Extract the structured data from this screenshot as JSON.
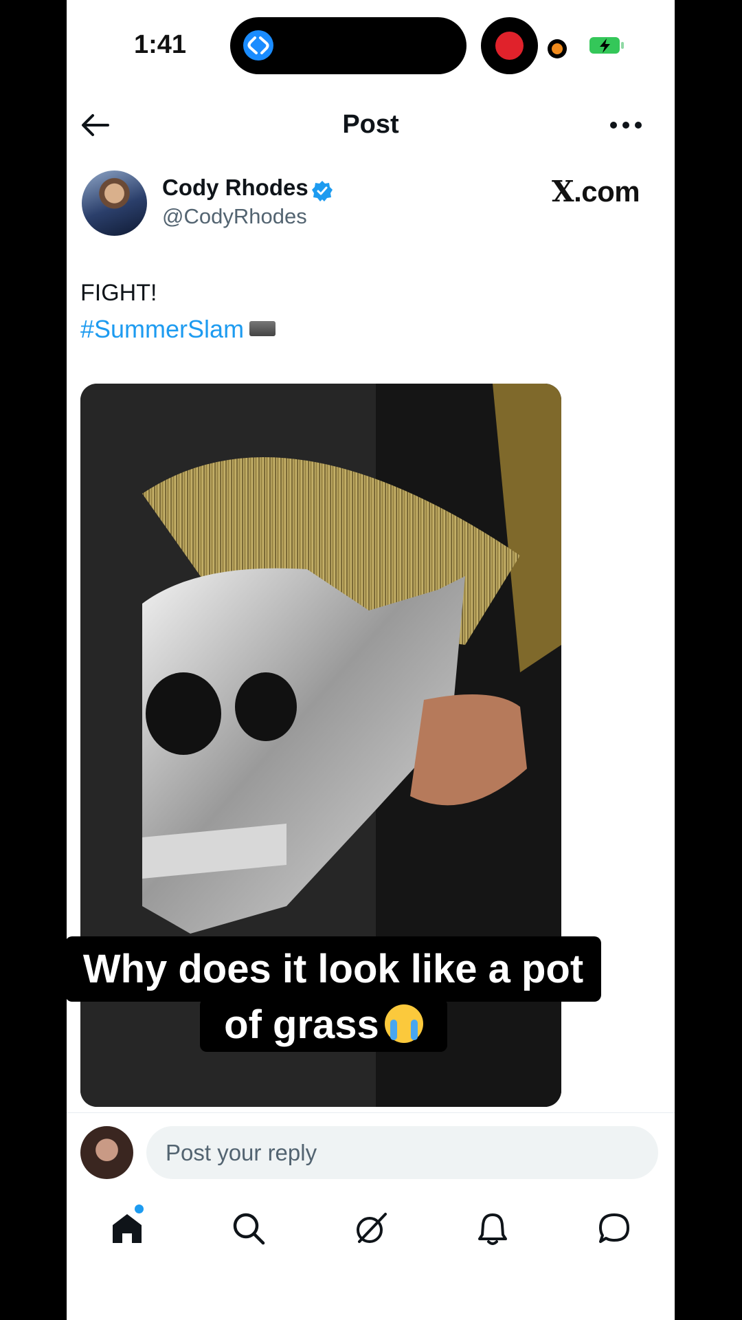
{
  "status": {
    "time": "1:41"
  },
  "header": {
    "title": "Post"
  },
  "author": {
    "name": "Cody Rhodes",
    "handle": "@CodyRhodes"
  },
  "watermark": "X.com",
  "post": {
    "text": "FIGHT!",
    "hashtag": "#SummerSlam"
  },
  "caption": {
    "line1": "Why does it look like a pot",
    "line2": "of grass"
  },
  "reply": {
    "placeholder": "Post your reply"
  },
  "nav": {
    "items": [
      "home-icon",
      "search-icon",
      "grok-icon",
      "notifications-icon",
      "messages-icon"
    ],
    "home_has_dot": true
  },
  "colors": {
    "accent": "#1d9bf0",
    "record": "#e0222b",
    "battery": "#34c759"
  }
}
